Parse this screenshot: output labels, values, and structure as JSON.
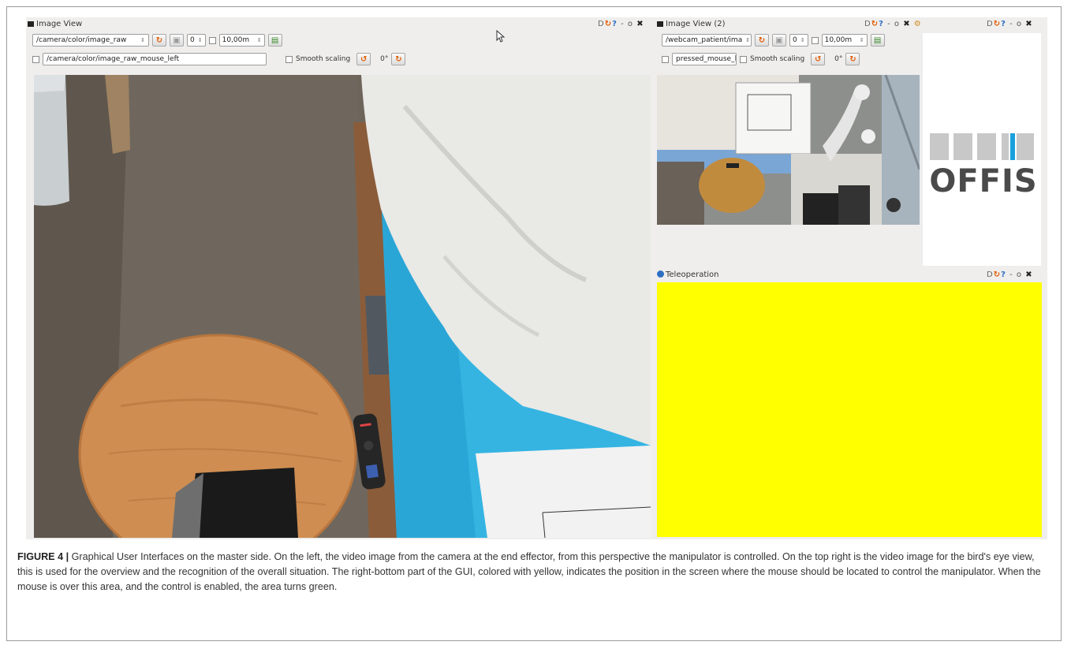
{
  "left_panel": {
    "title": "Image View",
    "topic": "/camera/color/image_raw",
    "number": "0",
    "distance": "10,00m",
    "mouse_topic": "/camera/color/image_raw_mouse_left",
    "smooth_scaling_label": "Smooth scaling",
    "rotation": "0°"
  },
  "right_panel": {
    "title": "Image View (2)",
    "topic": "/webcam_patient/ima",
    "number": "0",
    "distance": "10,00m",
    "mouse_topic": "pressed_mouse_left",
    "smooth_scaling_label": "Smooth scaling",
    "rotation": "0°"
  },
  "teleoperation": {
    "title": "Teleoperation",
    "area_color": "#ffff00"
  },
  "window_controls": {
    "text": "D",
    "minimize": "-",
    "float": "o",
    "close": "✖"
  },
  "logo": {
    "text": "OFFIS",
    "colors": {
      "bars": "#c8c8c8",
      "accent": "#1aa0dc",
      "text": "#4a4a4a"
    }
  },
  "caption": {
    "label": "FIGURE 4 |",
    "text": "Graphical User Interfaces on the master side. On the left, the video image from the camera at the end effector, from this perspective the manipulator is controlled. On the top right is the video image for the bird's eye view, this is used for the overview and the recognition of the overall situation. The right-bottom part of the GUI, colored with yellow, indicates the position in the screen where the mouse should be located to control the manipulator. When the mouse is over this area, and the control is enabled, the area turns green."
  }
}
